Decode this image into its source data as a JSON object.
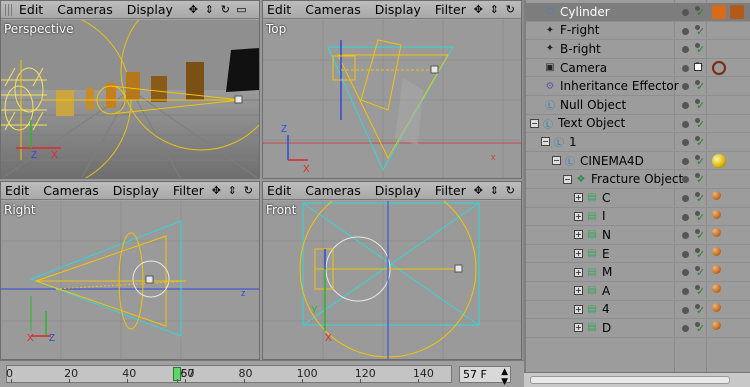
{
  "viewport_menu": {
    "edit": "Edit",
    "cameras": "Cameras",
    "display": "Display",
    "filter": "Filter"
  },
  "viewports": [
    {
      "label": "Perspective",
      "show_filter": false
    },
    {
      "label": "Top",
      "show_filter": true
    },
    {
      "label": "Right",
      "show_filter": true
    },
    {
      "label": "Front",
      "show_filter": true
    }
  ],
  "axes": {
    "x": "X",
    "y": "Y",
    "z": "Z"
  },
  "timeline": {
    "ticks": [
      "0",
      "20",
      "40",
      "57",
      "60",
      "80",
      "100",
      "120",
      "140"
    ],
    "current_frame": "57 F",
    "playhead_frame": 57,
    "max_frame": 150
  },
  "object_manager": {
    "items": [
      {
        "name": "Cylinder",
        "icon": "cylinder-icon",
        "selected": true
      },
      {
        "name": "F-right",
        "icon": "light-icon"
      },
      {
        "name": "B-right",
        "icon": "light-icon"
      },
      {
        "name": "Camera",
        "icon": "camera-icon"
      },
      {
        "name": "Inheritance Effector",
        "icon": "effector-icon"
      },
      {
        "name": "Null Object",
        "icon": "null-icon"
      },
      {
        "name": "Text Object",
        "icon": "null-icon"
      },
      {
        "name": "1",
        "icon": "null-icon"
      },
      {
        "name": "CINEMA4D",
        "icon": "null-icon"
      },
      {
        "name": "Fracture Object",
        "icon": "fracture-icon"
      },
      {
        "name": "C",
        "icon": "extrude-icon"
      },
      {
        "name": "I",
        "icon": "extrude-icon"
      },
      {
        "name": "N",
        "icon": "extrude-icon"
      },
      {
        "name": "E",
        "icon": "extrude-icon"
      },
      {
        "name": "M",
        "icon": "extrude-icon"
      },
      {
        "name": "A",
        "icon": "extrude-icon"
      },
      {
        "name": "4",
        "icon": "extrude-icon"
      },
      {
        "name": "D",
        "icon": "extrude-icon"
      }
    ]
  },
  "colors": {
    "accent_yellow": "#f2c40a",
    "cyan": "#35d6d6",
    "axis_red": "#e02828",
    "axis_blue": "#2c4bd8",
    "axis_green": "#2db52d"
  }
}
